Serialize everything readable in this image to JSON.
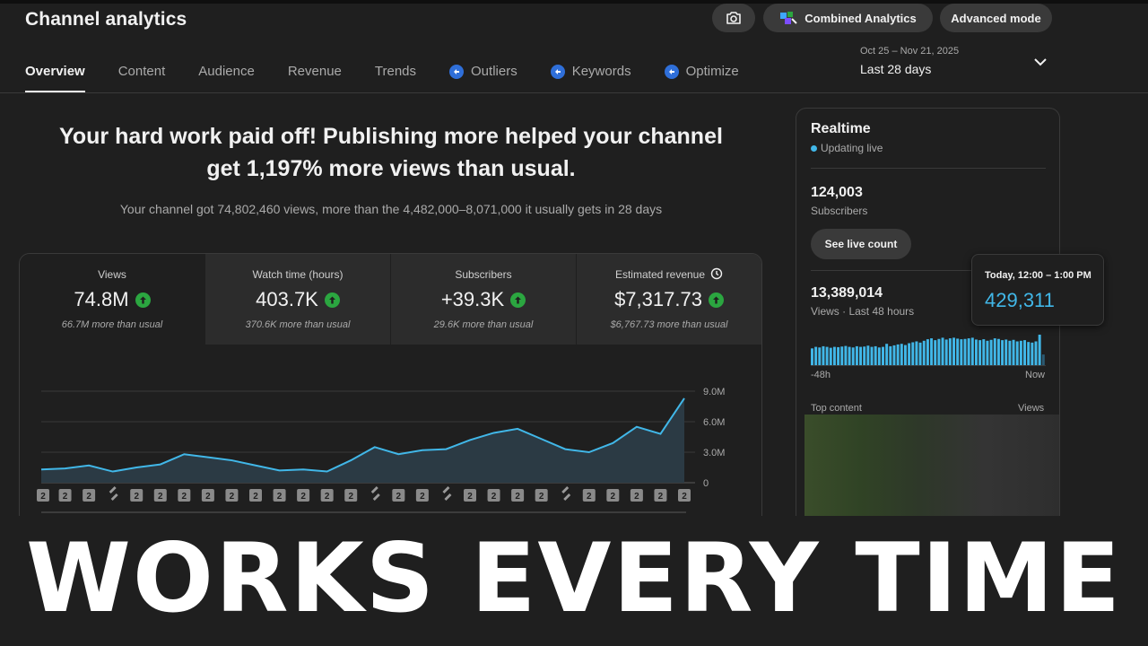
{
  "header": {
    "title": "Channel analytics",
    "combined_label": "Combined Analytics",
    "advanced_label": "Advanced mode",
    "camera_icon": "camera-icon"
  },
  "tabs": [
    {
      "label": "Overview",
      "active": true,
      "icon": ""
    },
    {
      "label": "Content",
      "active": false,
      "icon": ""
    },
    {
      "label": "Audience",
      "active": false,
      "icon": ""
    },
    {
      "label": "Revenue",
      "active": false,
      "icon": ""
    },
    {
      "label": "Trends",
      "active": false,
      "icon": ""
    },
    {
      "label": "Outliers",
      "active": false,
      "icon": "extension-icon"
    },
    {
      "label": "Keywords",
      "active": false,
      "icon": "extension-icon"
    },
    {
      "label": "Optimize",
      "active": false,
      "icon": "extension-icon"
    }
  ],
  "date_range": {
    "dates": "Oct 25 – Nov 21, 2025",
    "period": "Last 28 days"
  },
  "headline": {
    "title_line1": "Your hard work paid off! Publishing more helped your channel",
    "title_line2": "get 1,197% more views than usual.",
    "subtitle": "Your channel got 74,802,460 views, more than the 4,482,000–8,071,000 it usually gets in 28 days"
  },
  "metrics": [
    {
      "label": "Views",
      "value": "74.8M",
      "note": "66.7M more than usual",
      "active": true
    },
    {
      "label": "Watch time (hours)",
      "value": "403.7K",
      "note": "370.6K more than usual",
      "active": false
    },
    {
      "label": "Subscribers",
      "value": "+39.3K",
      "note": "29.6K more than usual",
      "active": false
    },
    {
      "label": "Estimated revenue",
      "value": "$7,317.73",
      "note": "$6,767.73 more than usual",
      "active": false
    }
  ],
  "chart_data": {
    "type": "area",
    "series": [
      {
        "values": [
          1.3,
          1.4,
          1.7,
          1.1,
          1.5,
          1.8,
          2.8,
          2.5,
          2.2,
          1.7,
          1.2,
          1.3,
          1.1,
          2.2,
          3.5,
          2.8,
          3.2,
          3.3,
          4.2,
          4.9,
          5.3,
          4.3,
          3.3,
          3.0,
          3.9,
          5.5,
          4.8,
          8.3
        ]
      }
    ],
    "yticks": [
      "9.0M",
      "6.0M",
      "3.0M",
      "0"
    ],
    "ylim": [
      0,
      9
    ],
    "markers": [
      "short",
      "short",
      "short",
      "video",
      "short",
      "short",
      "short",
      "short",
      "short",
      "short",
      "short",
      "short",
      "short",
      "short",
      "video",
      "short",
      "short",
      "video",
      "short",
      "short",
      "short",
      "short",
      "video",
      "short",
      "short",
      "short",
      "short",
      "short"
    ],
    "marker_label": "2",
    "color": "#41b7e8"
  },
  "realtime": {
    "title": "Realtime",
    "status": "Updating live",
    "subscribers_value": "124,003",
    "subscribers_label": "Subscribers",
    "live_count_button": "See live count",
    "views_value": "13,389,014",
    "views_label": "Views · Last 48 hours",
    "axis_left": "-48h",
    "axis_right": "Now",
    "top_content_label": "Top content",
    "views_col_label": "Views",
    "bars": [
      0.55,
      0.6,
      0.58,
      0.62,
      0.6,
      0.57,
      0.6,
      0.59,
      0.61,
      0.63,
      0.6,
      0.58,
      0.62,
      0.6,
      0.61,
      0.64,
      0.6,
      0.62,
      0.58,
      0.6,
      0.7,
      0.62,
      0.65,
      0.68,
      0.7,
      0.66,
      0.72,
      0.75,
      0.78,
      0.74,
      0.8,
      0.85,
      0.88,
      0.82,
      0.86,
      0.9,
      0.84,
      0.88,
      0.9,
      0.87,
      0.85,
      0.86,
      0.88,
      0.9,
      0.84,
      0.82,
      0.85,
      0.8,
      0.83,
      0.88,
      0.86,
      0.82,
      0.84,
      0.8,
      0.83,
      0.78,
      0.8,
      0.82,
      0.76,
      0.74,
      0.78,
      1.0,
      0.35
    ],
    "accent": "#41b7e8"
  },
  "tooltip": {
    "label": "Today, 12:00 – 1:00 PM",
    "value": "429,311"
  },
  "banner": {
    "text": "WORKS EVERY TIME"
  }
}
